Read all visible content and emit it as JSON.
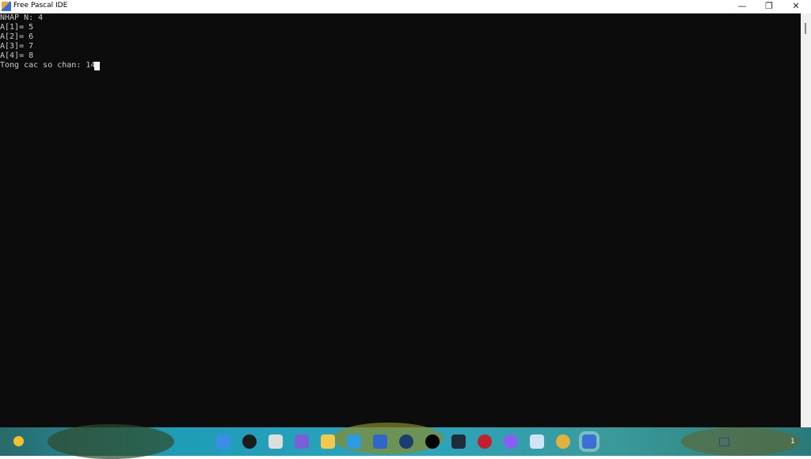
{
  "window": {
    "title": "Free Pascal IDE",
    "minimize": "—",
    "restore": "❐",
    "close": "✕"
  },
  "console": {
    "lines": [
      "NHAP N: 4",
      "A[1]= 5",
      "A[2]= 6",
      "A[3]= 7",
      "A[4]= 8",
      "Tong cac so chan: 14"
    ],
    "background": "#0c0c0c",
    "text_color": "#cccccc"
  },
  "taskbar": {
    "apps": [
      {
        "name": "start",
        "color": "#3a8ee6"
      },
      {
        "name": "search",
        "color": "#1b1b1b"
      },
      {
        "name": "task-view",
        "color": "#dddddd"
      },
      {
        "name": "teams-chat",
        "color": "#7b5fd6"
      },
      {
        "name": "file-explorer",
        "color": "#f2c94c"
      },
      {
        "name": "edge",
        "color": "#2e9be0"
      },
      {
        "name": "store",
        "color": "#2f66c9"
      },
      {
        "name": "ccleaner",
        "color": "#1a3e6e"
      },
      {
        "name": "tiktok",
        "color": "#000000"
      },
      {
        "name": "app-download",
        "color": "#1f2d3a"
      },
      {
        "name": "red-app",
        "color": "#c2202a"
      },
      {
        "name": "messenger",
        "color": "#8b5cf6"
      },
      {
        "name": "photos",
        "color": "#cfe3f3"
      },
      {
        "name": "chrome",
        "color": "#e3b23c"
      },
      {
        "name": "free-pascal",
        "color": "#3b6fd6"
      }
    ],
    "notification_count": "1"
  }
}
